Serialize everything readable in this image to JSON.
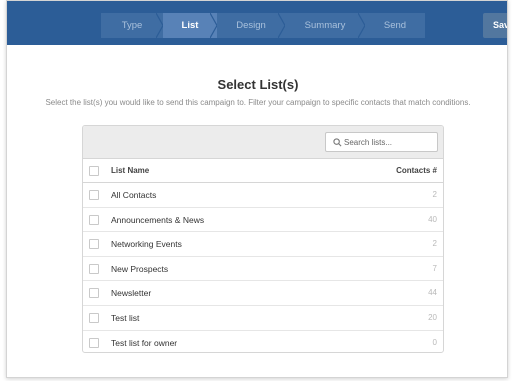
{
  "steps": [
    {
      "label": "Type",
      "active": false
    },
    {
      "label": "List",
      "active": true
    },
    {
      "label": "Design",
      "active": false
    },
    {
      "label": "Summary",
      "active": false
    },
    {
      "label": "Send",
      "active": false
    }
  ],
  "save_label": "Save",
  "title": "Select List(s)",
  "subtitle": "Select the list(s) you would like to send this campaign to. Filter your campaign to specific contacts that match conditions.",
  "search": {
    "placeholder": "Search lists..."
  },
  "table": {
    "columns": {
      "name": "List Name",
      "count": "Contacts #"
    },
    "rows": [
      {
        "name": "All Contacts",
        "count": "2"
      },
      {
        "name": "Announcements & News",
        "count": "40"
      },
      {
        "name": "Networking Events",
        "count": "2"
      },
      {
        "name": "New Prospects",
        "count": "7"
      },
      {
        "name": "Newsletter",
        "count": "44"
      },
      {
        "name": "Test list",
        "count": "20"
      },
      {
        "name": "Test list for owner",
        "count": "0"
      }
    ]
  },
  "colors": {
    "header_bg": "#2c5d97",
    "step_bg": "#3f6da3",
    "step_active_bg": "#5882b7"
  },
  "icons": {
    "search": "search-icon"
  }
}
